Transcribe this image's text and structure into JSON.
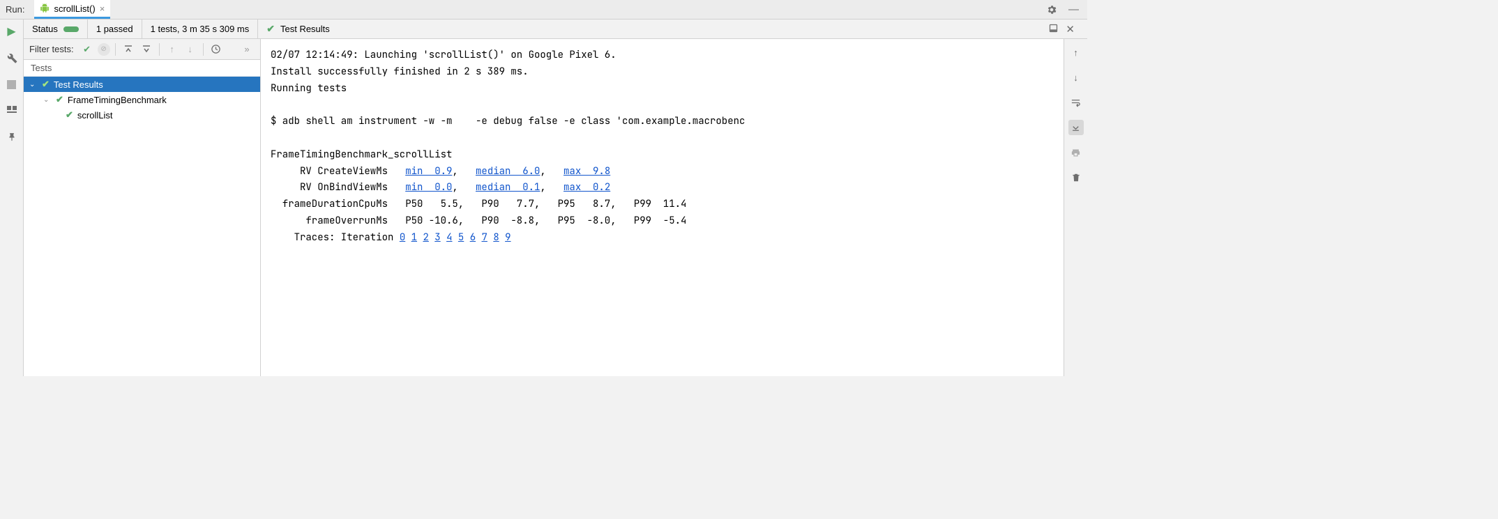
{
  "topbar": {
    "run_label": "Run:",
    "tab_name": "scrollList()"
  },
  "status": {
    "label": "Status",
    "passed_text": "1 passed",
    "summary_text": "1 tests, 3 m 35 s 309 ms",
    "right_label": "Test Results"
  },
  "filter": {
    "label": "Filter tests:"
  },
  "tests_header": "Tests",
  "tree": {
    "root": "Test Results",
    "class": "FrameTimingBenchmark",
    "method": "scrollList"
  },
  "console": {
    "line1": "02/07 12:14:49: Launching 'scrollList()' on Google Pixel 6.",
    "line2": "Install successfully finished in 2 s 389 ms.",
    "line3": "Running tests",
    "line4_prefix": "$ adb shell am instrument -w -m    -e debug false -e class 'com.example.macrobenc",
    "bench_header": "FrameTimingBenchmark_scrollList",
    "row1_label": "RV CreateViewMs",
    "row1_min": "min  0.9",
    "row1_med": "median  6.0",
    "row1_max": "max  9.8",
    "row2_label": "RV OnBindViewMs",
    "row2_min": "min  0.0",
    "row2_med": "median  0.1",
    "row2_max": "max  0.2",
    "row3": "  frameDurationCpuMs   P50   5.5,   P90   7.7,   P95   8.7,   P99  11.4",
    "row4": "      frameOverrunMs   P50 -10.6,   P90  -8.8,   P95  -8.0,   P99  -5.4",
    "traces_label": "Traces: Iteration",
    "trace_links": [
      "0",
      "1",
      "2",
      "3",
      "4",
      "5",
      "6",
      "7",
      "8",
      "9"
    ]
  }
}
